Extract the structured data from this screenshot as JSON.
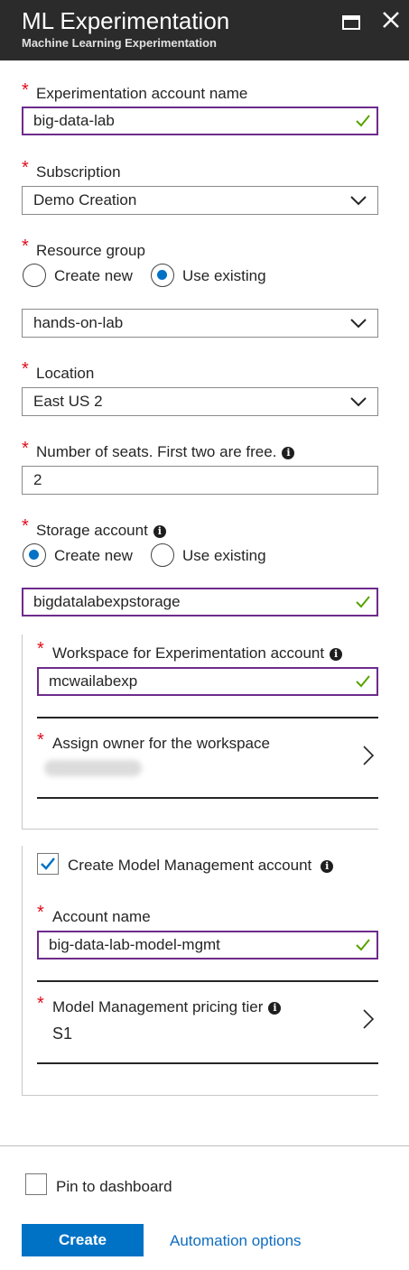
{
  "header": {
    "title": "ML Experimentation",
    "subtitle": "Machine Learning Experimentation"
  },
  "required_marker": "*",
  "experimentation_account": {
    "label": "Experimentation account name",
    "value": "big-data-lab"
  },
  "subscription": {
    "label": "Subscription",
    "value": "Demo Creation"
  },
  "resource_group": {
    "label": "Resource group",
    "option_create": "Create new",
    "option_existing": "Use existing",
    "selected": "Use existing",
    "value": "hands-on-lab"
  },
  "location": {
    "label": "Location",
    "value": "East US 2"
  },
  "seats": {
    "label": "Number of seats. First two are free.",
    "value": "2"
  },
  "storage": {
    "label": "Storage account",
    "option_create": "Create new",
    "option_existing": "Use existing",
    "selected": "Create new",
    "value": "bigdatalabexpstorage"
  },
  "workspace": {
    "label": "Workspace for Experimentation account",
    "value": "mcwailabexp"
  },
  "owner": {
    "label": "Assign owner for the workspace"
  },
  "model_management": {
    "checkbox_label": "Create Model Management account",
    "checked": true,
    "account_label": "Account name",
    "account_value": "big-data-lab-model-mgmt",
    "tier_label": "Model Management pricing tier",
    "tier_value": "S1"
  },
  "footer": {
    "pin_label": "Pin to dashboard",
    "pinned": false,
    "create_label": "Create",
    "automation_label": "Automation options"
  },
  "colors": {
    "header_bg": "#2b2b2b",
    "accent_blue": "#0072c6",
    "valid_border": "#6d2b8c",
    "valid_check": "#57a300",
    "required": "#e00b1c",
    "link": "#0f6dbf"
  },
  "icons": {
    "maximize": "maximize-icon",
    "close": "close-icon",
    "info": "info-icon",
    "check": "checkmark-icon",
    "dropdown": "chevron-down-icon",
    "navigate": "chevron-right-icon"
  }
}
